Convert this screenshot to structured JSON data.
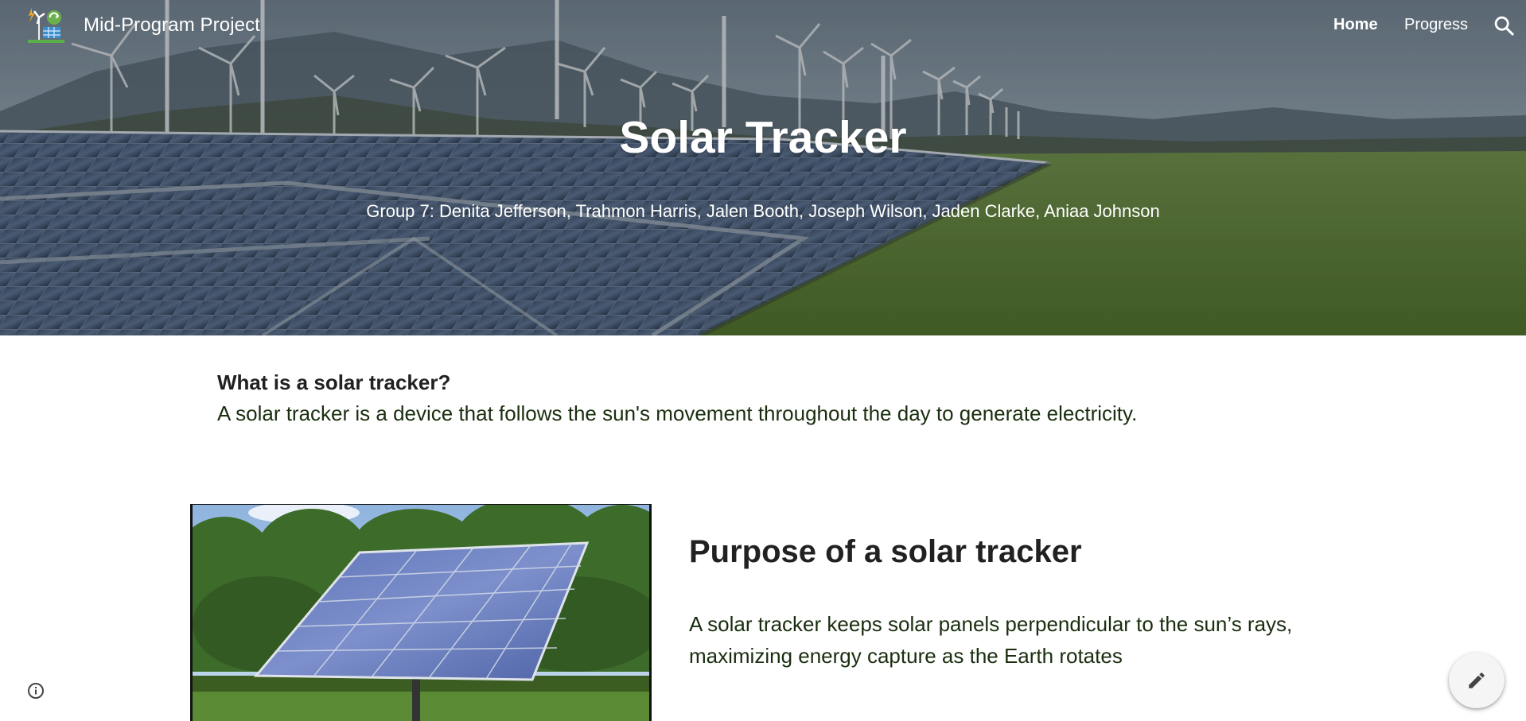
{
  "header": {
    "site_title": "Mid-Program Project",
    "nav": {
      "home": "Home",
      "progress": "Progress"
    }
  },
  "hero": {
    "title": "Solar Tracker",
    "subtitle": "Group 7: Denita Jefferson, Trahmon Harris, Jalen Booth, Joseph Wilson, Jaden Clarke, Aniaa Johnson"
  },
  "intro": {
    "heading": "What is a solar tracker?",
    "text": "A solar tracker is a device that follows the sun's movement throughout the day to generate electricity."
  },
  "purpose": {
    "heading": "Purpose of a solar tracker",
    "text": "A solar tracker keeps solar panels perpendicular to the sun’s rays, maximizing energy capture as the Earth rotates"
  },
  "icons": {
    "logo": "wind-solar-logo-icon",
    "search": "search-icon",
    "info": "info-icon",
    "edit": "pencil-icon"
  },
  "colors": {
    "nav_text": "#ffffff",
    "body_text": "#1a2e0f",
    "heading_text": "#212121"
  }
}
